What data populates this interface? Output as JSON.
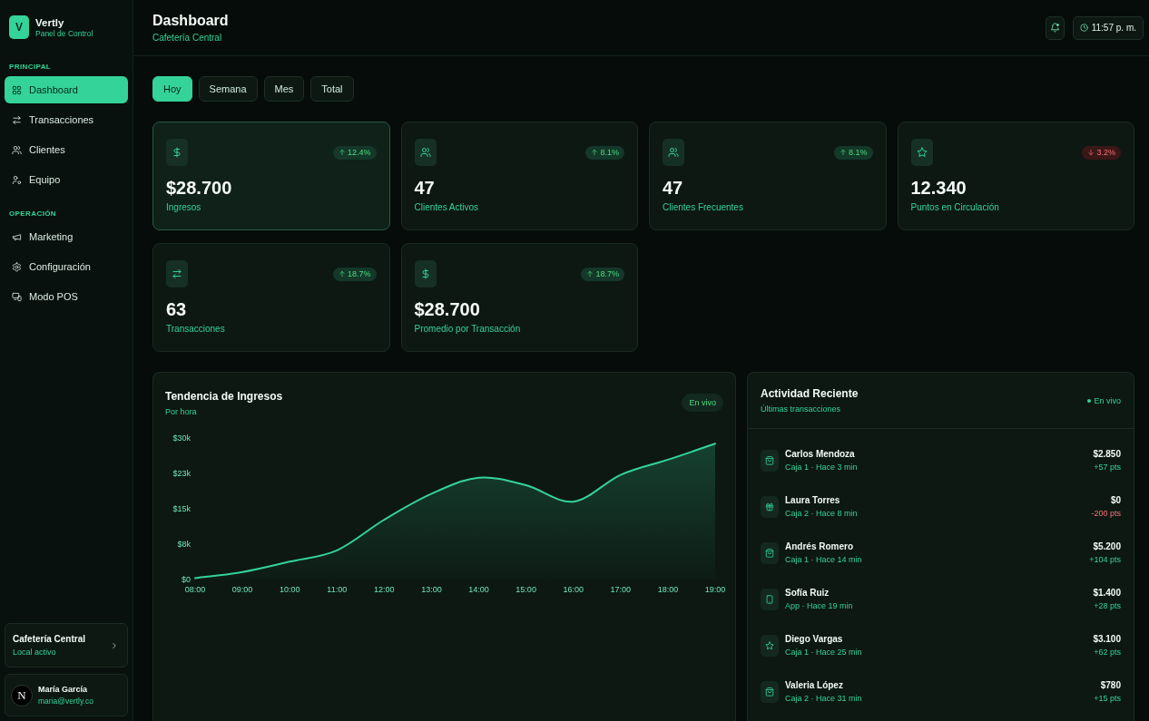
{
  "sidebar": {
    "brand": {
      "logo_letter": "V",
      "name": "Vertly",
      "subtitle": "Panel de Control"
    },
    "sections": [
      {
        "title": "PRINCIPAL",
        "items": [
          {
            "label": "Dashboard",
            "selected": true
          },
          {
            "label": "Transacciones",
            "selected": false
          },
          {
            "label": "Clientes",
            "selected": false
          },
          {
            "label": "Equipo",
            "selected": false
          }
        ]
      },
      {
        "title": "OPERACIÓN",
        "items": [
          {
            "label": "Marketing",
            "selected": false
          },
          {
            "label": "Configuración",
            "selected": false
          },
          {
            "label": "Modo POS",
            "selected": false
          }
        ]
      }
    ],
    "store_card": {
      "name": "Cafetería Central",
      "status": "Local activo"
    },
    "user_card": {
      "badge": "N",
      "name": "María García",
      "email": "maria@vertly.co"
    }
  },
  "header": {
    "title": "Dashboard",
    "subtitle": "Cafetería Central",
    "time": "11:57 p. m."
  },
  "period_tabs": [
    {
      "label": "Hoy",
      "selected": true
    },
    {
      "label": "Semana",
      "selected": false
    },
    {
      "label": "Mes",
      "selected": false
    },
    {
      "label": "Total",
      "selected": false
    }
  ],
  "stat_cards": [
    {
      "value": "$28.700",
      "label": "Ingresos",
      "change": "12.4%",
      "negative": false,
      "highlighted": true
    },
    {
      "value": "47",
      "label": "Clientes Activos",
      "change": "8.1%",
      "negative": false,
      "highlighted": false
    },
    {
      "value": "47",
      "label": "Clientes Frecuentes",
      "change": "8.1%",
      "negative": false,
      "highlighted": false
    },
    {
      "value": "12.340",
      "label": "Puntos en Circulación",
      "change": "3.2%",
      "negative": true,
      "highlighted": false
    },
    {
      "value": "63",
      "label": "Transacciones",
      "change": "18.7%",
      "negative": false,
      "highlighted": false
    },
    {
      "value": "$28.700",
      "label": "Promedio por Transacción",
      "change": "18.7%",
      "negative": false,
      "highlighted": false
    }
  ],
  "revenue_chart": {
    "title": "Tendencia de Ingresos",
    "subtitle": "Por hora",
    "live_badge": "En vivo",
    "chart_data": {
      "type": "area",
      "categories": [
        "08:00",
        "09:00",
        "10:00",
        "11:00",
        "12:00",
        "13:00",
        "14:00",
        "15:00",
        "16:00",
        "17:00",
        "18:00",
        "19:00"
      ],
      "series": [
        {
          "color": "#34d399",
          "values": [
            300,
            1600,
            3800,
            6200,
            12700,
            18200,
            21600,
            20000,
            16500,
            22200,
            25400,
            28800
          ]
        }
      ],
      "ylim": [
        0,
        30000
      ],
      "yticks": [
        {
          "value": 0,
          "label": "$0"
        },
        {
          "value": 7500,
          "label": "$8k"
        },
        {
          "value": 15000,
          "label": "$15k"
        },
        {
          "value": 22500,
          "label": "$23k"
        },
        {
          "value": 30000,
          "label": "$30k"
        }
      ]
    }
  },
  "recent_activity": {
    "title": "Actividad Reciente",
    "subtitle": "Últimas transacciones",
    "live_label": "En vivo",
    "items": [
      {
        "name": "Carlos Mendoza",
        "detail": "Caja 1 · Hace 3 min",
        "amount": "$2.850",
        "points": "+57 pts",
        "negative": false
      },
      {
        "name": "Laura Torres",
        "detail": "Caja 2 · Hace 8 min",
        "amount": "$0",
        "points": "-200 pts",
        "negative": true
      },
      {
        "name": "Andrés Romero",
        "detail": "Caja 1 · Hace 14 min",
        "amount": "$5.200",
        "points": "+104 pts",
        "negative": false
      },
      {
        "name": "Sofía Ruiz",
        "detail": "App · Hace 19 min",
        "amount": "$1.400",
        "points": "+28 pts",
        "negative": false
      },
      {
        "name": "Diego Vargas",
        "detail": "Caja 1 · Hace 25 min",
        "amount": "$3.100",
        "points": "+62 pts",
        "negative": false
      },
      {
        "name": "Valeria López",
        "detail": "Caja 2 · Hace 31 min",
        "amount": "$780",
        "points": "+15 pts",
        "negative": false
      }
    ]
  }
}
